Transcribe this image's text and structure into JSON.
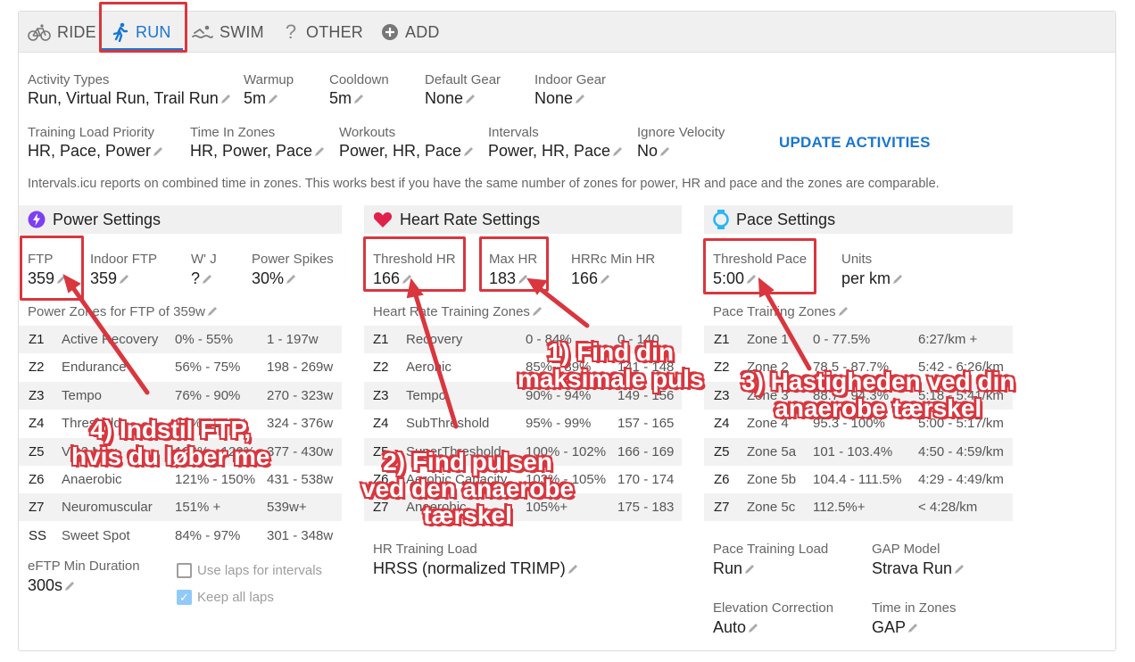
{
  "tabs": [
    {
      "label": "RIDE",
      "icon": "bike-icon"
    },
    {
      "label": "RUN",
      "icon": "run-icon"
    },
    {
      "label": "SWIM",
      "icon": "swim-icon"
    },
    {
      "label": "OTHER",
      "icon": "question-icon"
    },
    {
      "label": "ADD",
      "icon": "add-circle-icon"
    }
  ],
  "general": {
    "activity_types": {
      "label": "Activity Types",
      "value": "Run, Virtual Run, Trail Run"
    },
    "warmup": {
      "label": "Warmup",
      "value": "5m"
    },
    "cooldown": {
      "label": "Cooldown",
      "value": "5m"
    },
    "default_gear": {
      "label": "Default Gear",
      "value": "None"
    },
    "indoor_gear": {
      "label": "Indoor Gear",
      "value": "None"
    },
    "training_load_priority": {
      "label": "Training Load Priority",
      "value": "HR, Pace, Power"
    },
    "time_in_zones": {
      "label": "Time In Zones",
      "value": "HR, Power, Pace"
    },
    "workouts": {
      "label": "Workouts",
      "value": "Power, HR, Pace"
    },
    "intervals": {
      "label": "Intervals",
      "value": "Power, HR, Pace"
    },
    "ignore_velocity": {
      "label": "Ignore Velocity",
      "value": "No"
    },
    "update_button": "UPDATE ACTIVITIES",
    "note": "Intervals.icu reports on combined time in zones. This works best if you have the same number of zones for power, HR and pace and the zones are comparable."
  },
  "power": {
    "title": "Power Settings",
    "ftp": {
      "label": "FTP",
      "value": "359"
    },
    "indoor_ftp": {
      "label": "Indoor FTP",
      "value": "359"
    },
    "wj": {
      "label": "W' J",
      "value": "?"
    },
    "spikes": {
      "label": "Power Spikes",
      "value": "30%"
    },
    "zones_title": "Power Zones for FTP of 359w",
    "zones": [
      {
        "id": "Z1",
        "name": "Active Recovery",
        "pct": "0% - 55%",
        "range": "1 - 197w"
      },
      {
        "id": "Z2",
        "name": "Endurance",
        "pct": "56% - 75%",
        "range": "198 - 269w"
      },
      {
        "id": "Z3",
        "name": "Tempo",
        "pct": "76% - 90%",
        "range": "270 - 323w"
      },
      {
        "id": "Z4",
        "name": "Threshold",
        "pct": "91% - 105%",
        "range": "324 - 376w"
      },
      {
        "id": "Z5",
        "name": "VO2 Max",
        "pct": "106% - 120%",
        "range": "377 - 430w"
      },
      {
        "id": "Z6",
        "name": "Anaerobic",
        "pct": "121% - 150%",
        "range": "431 - 538w"
      },
      {
        "id": "Z7",
        "name": "Neuromuscular",
        "pct": "151% +",
        "range": "539w+"
      },
      {
        "id": "SS",
        "name": "Sweet Spot",
        "pct": "84% - 97%",
        "range": "301 - 348w"
      }
    ],
    "eftp": {
      "label": "eFTP Min Duration",
      "value": "300s"
    },
    "use_laps": "Use laps for intervals",
    "keep_laps": "Keep all laps"
  },
  "hr": {
    "title": "Heart Rate Settings",
    "threshold": {
      "label": "Threshold HR",
      "value": "166"
    },
    "max": {
      "label": "Max HR",
      "value": "183"
    },
    "hrrc": {
      "label": "HRRc Min HR",
      "value": "166"
    },
    "zones_title": "Heart Rate Training Zones",
    "zones": [
      {
        "id": "Z1",
        "name": "Recovery",
        "pct": "0 - 84%",
        "range": "0 - 140"
      },
      {
        "id": "Z2",
        "name": "Aerobic",
        "pct": "85% - 89%",
        "range": "141 - 148"
      },
      {
        "id": "Z3",
        "name": "Tempo",
        "pct": "90% - 94%",
        "range": "149 - 156"
      },
      {
        "id": "Z4",
        "name": "SubThreshold",
        "pct": "95% - 99%",
        "range": "157 - 165"
      },
      {
        "id": "Z5",
        "name": "SuperThreshold",
        "pct": "100% - 102%",
        "range": "166 - 169"
      },
      {
        "id": "Z6",
        "name": "Aerobic Capacity",
        "pct": "103% - 105%",
        "range": "170 - 174"
      },
      {
        "id": "Z7",
        "name": "Anaerobic",
        "pct": "105%+",
        "range": "175 - 183"
      }
    ],
    "load": {
      "label": "HR Training Load",
      "value": "HRSS (normalized TRIMP)"
    }
  },
  "pace": {
    "title": "Pace Settings",
    "threshold": {
      "label": "Threshold Pace",
      "value": "5:00"
    },
    "units": {
      "label": "Units",
      "value": "per km"
    },
    "zones_title": "Pace Training Zones",
    "zones": [
      {
        "id": "Z1",
        "name": "Zone 1",
        "pct": "0 - 77.5%",
        "range": "6:27/km +"
      },
      {
        "id": "Z2",
        "name": "Zone 2",
        "pct": "78.5 - 87.7%",
        "range": "5:42 - 6:26/km"
      },
      {
        "id": "Z3",
        "name": "Zone 3",
        "pct": "88.7 - 94.3%",
        "range": "5:18 - 5:41/km"
      },
      {
        "id": "Z4",
        "name": "Zone 4",
        "pct": "95.3 - 100%",
        "range": "5:00 - 5:17/km"
      },
      {
        "id": "Z5",
        "name": "Zone 5a",
        "pct": "101 - 103.4%",
        "range": "4:50 - 4:59/km"
      },
      {
        "id": "Z6",
        "name": "Zone 5b",
        "pct": "104.4 - 111.5%",
        "range": "4:29 - 4:49/km"
      },
      {
        "id": "Z7",
        "name": "Zone 5c",
        "pct": "112.5%+",
        "range": "< 4:28/km"
      }
    ],
    "load": {
      "label": "Pace Training Load",
      "value": "Run"
    },
    "gap": {
      "label": "GAP Model",
      "value": "Strava Run"
    },
    "elevation": {
      "label": "Elevation Correction",
      "value": "Auto"
    },
    "tiz": {
      "label": "Time in Zones",
      "value": "GAP"
    }
  },
  "annotations": {
    "a1": [
      "1) Find din",
      "maksimale puls"
    ],
    "a2": [
      "2) Find pulsen",
      "ved den anaerobe",
      "tærskel"
    ],
    "a3": [
      "3) Hastigheden ved din",
      "anaerobe tærskel"
    ],
    "a4": [
      "4) Indstil FTP,",
      "hvis du løber me"
    ]
  },
  "colors": {
    "accent": "#1976d2",
    "annotation_red": "#d9363e",
    "power_icon": "#7e3ff2",
    "heart_icon": "#e0224a",
    "pace_icon": "#29b6f6"
  }
}
